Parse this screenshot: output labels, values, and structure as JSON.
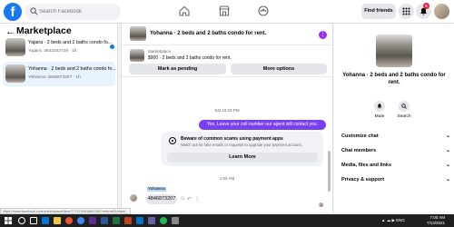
{
  "topbar": {
    "logo": "f",
    "search_placeholder": "Search Facebook",
    "find_friends": "Find friends",
    "notification_count": "5"
  },
  "sidebar": {
    "title": "Marketplace",
    "conversations": [
      {
        "title": "Yajaira · 2 beds and 2 baths condo fo...",
        "subtitle": "Yajaira: 4843343729 · 1h"
      },
      {
        "title": "Yohanna · 2 beds and 2 baths condo fo...",
        "subtitle": "Yohanna: 4846873207 · 1h"
      }
    ]
  },
  "chat": {
    "title": "Yohanna · 2 beds and 2 baths condo for rent.",
    "listing_category": "Marketplace",
    "listing_price": "$900 · 2 beds and 2 baths condo for rent.",
    "mark_pending": "Mark as pending",
    "more_options": "More options",
    "date": "Sat 10:18 PM",
    "outgoing_message": "Yes, Leave your cell number our agent will contact you.",
    "scam_title": "Beware of common scams using payment apps",
    "scam_sub": "Watch out for fake emails or requests to upgrade your payment account.",
    "learn_more": "Learn More",
    "time": "1:00 AM",
    "sender_name": "Yohanna",
    "incoming_message": "4846873207",
    "composer_placeholder": "Aa"
  },
  "rpanel": {
    "title": "Yohanna · 2 beds and 2 baths condo for rent.",
    "mute": "Mute",
    "search": "Search",
    "rows": [
      "Customize chat",
      "Chat members",
      "Media, files and links",
      "Privacy & support"
    ]
  },
  "status": {
    "url": "https://www.facebook.com/marketplace/item/777574061868785/?referralSurface..."
  },
  "taskbar": {
    "tray_text": "ENG",
    "time": "7:00 AM",
    "date": "7/13/2021"
  },
  "colors": {
    "brand": "#1877f2",
    "outgoing_bubble": "#7b3ff2",
    "badge": "#e41e3f"
  }
}
